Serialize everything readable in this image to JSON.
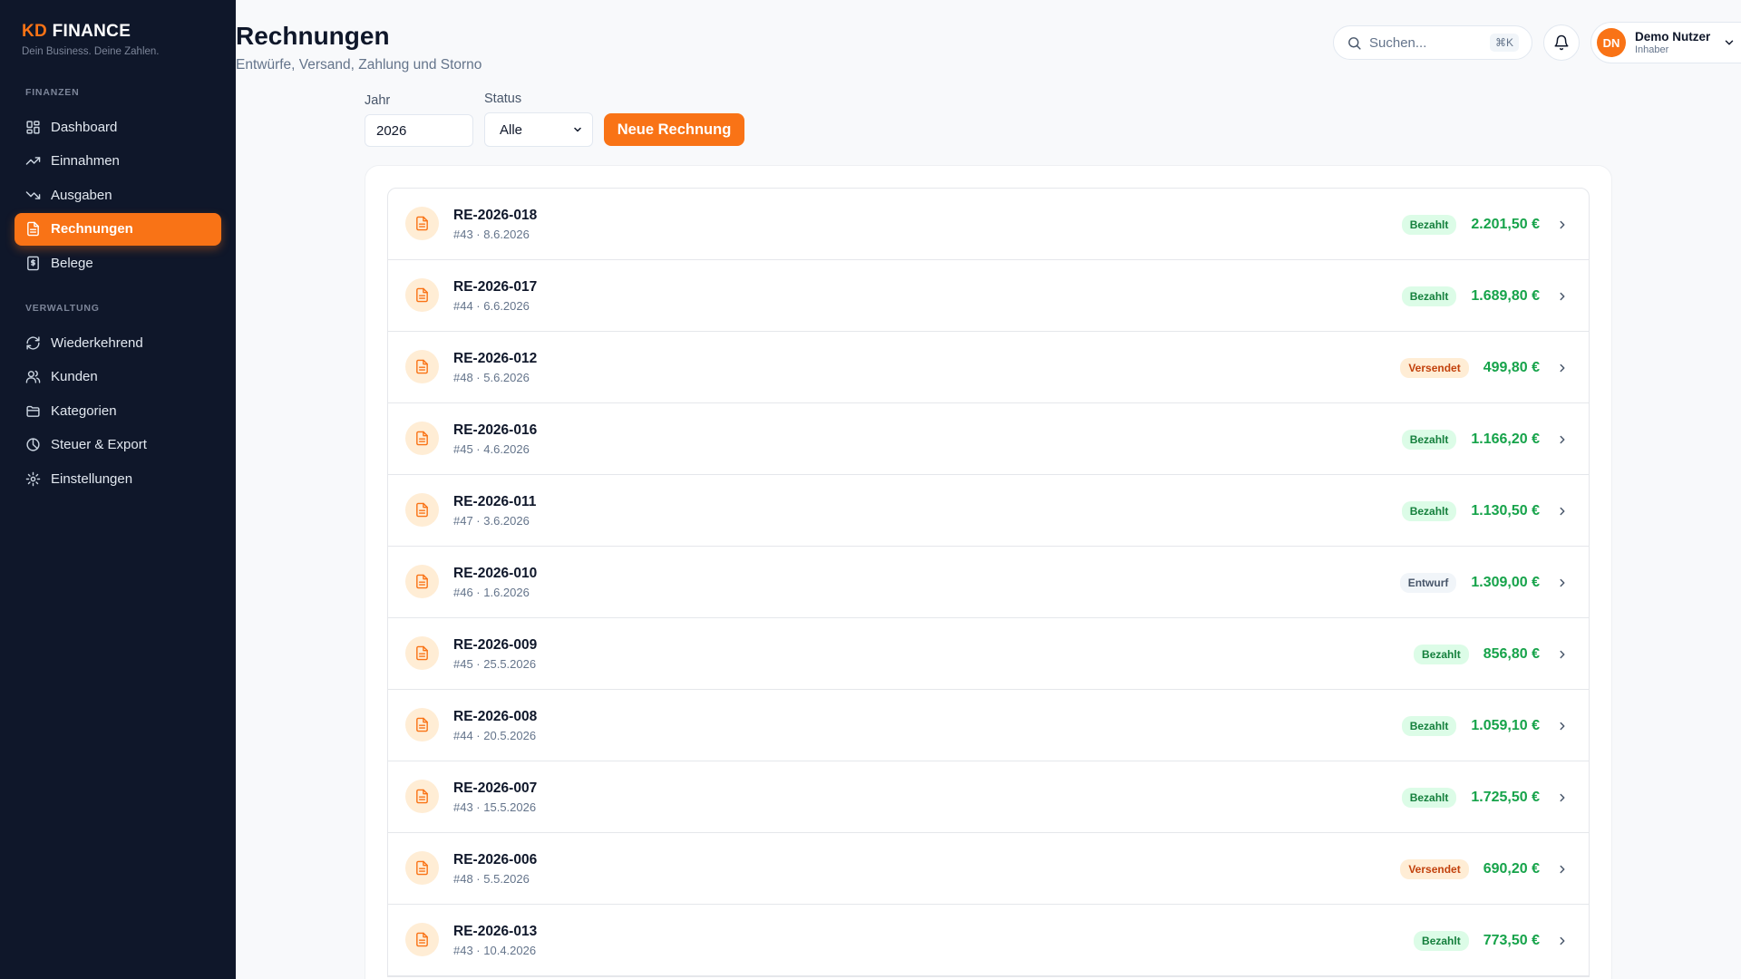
{
  "brand": {
    "kd": "KD",
    "name": " FINANCE",
    "tagline": "Dein Business. Deine Zahlen."
  },
  "sidebar": {
    "section_finance": "FINANZEN",
    "finance_items": [
      {
        "label": "Dashboard",
        "icon": "dashboard-icon"
      },
      {
        "label": "Einnahmen",
        "icon": "trending-up-icon"
      },
      {
        "label": "Ausgaben",
        "icon": "trending-down-icon"
      },
      {
        "label": "Rechnungen",
        "icon": "file-text-icon",
        "active": true
      },
      {
        "label": "Belege",
        "icon": "receipt-icon"
      }
    ],
    "section_admin": "VERWALTUNG",
    "admin_items": [
      {
        "label": "Wiederkehrend",
        "icon": "refresh-icon"
      },
      {
        "label": "Kunden",
        "icon": "users-icon"
      },
      {
        "label": "Kategorien",
        "icon": "folder-icon"
      },
      {
        "label": "Steuer & Export",
        "icon": "pie-chart-icon"
      },
      {
        "label": "Einstellungen",
        "icon": "gear-icon"
      }
    ]
  },
  "header": {
    "title": "Rechnungen",
    "subtitle": "Entwürfe, Versand, Zahlung und Storno",
    "search_placeholder": "Suchen...",
    "search_shortcut": "⌘K",
    "user_initials": "DN",
    "user_name": "Demo Nutzer",
    "user_role": "Inhaber"
  },
  "filters": {
    "year_label": "Jahr",
    "year_value": "2026",
    "status_label": "Status",
    "status_value": "Alle",
    "new_button": "Neue Rechnung"
  },
  "invoices": [
    {
      "number": "RE-2026-018",
      "meta": "#43 · 8.6.2026",
      "status": "Bezahlt",
      "status_kind": "bezahlt",
      "amount": "2.201,50 €"
    },
    {
      "number": "RE-2026-017",
      "meta": "#44 · 6.6.2026",
      "status": "Bezahlt",
      "status_kind": "bezahlt",
      "amount": "1.689,80 €"
    },
    {
      "number": "RE-2026-012",
      "meta": "#48 · 5.6.2026",
      "status": "Versendet",
      "status_kind": "versendet",
      "amount": "499,80 €"
    },
    {
      "number": "RE-2026-016",
      "meta": "#45 · 4.6.2026",
      "status": "Bezahlt",
      "status_kind": "bezahlt",
      "amount": "1.166,20 €"
    },
    {
      "number": "RE-2026-011",
      "meta": "#47 · 3.6.2026",
      "status": "Bezahlt",
      "status_kind": "bezahlt",
      "amount": "1.130,50 €"
    },
    {
      "number": "RE-2026-010",
      "meta": "#46 · 1.6.2026",
      "status": "Entwurf",
      "status_kind": "entwurf",
      "amount": "1.309,00 €"
    },
    {
      "number": "RE-2026-009",
      "meta": "#45 · 25.5.2026",
      "status": "Bezahlt",
      "status_kind": "bezahlt",
      "amount": "856,80 €"
    },
    {
      "number": "RE-2026-008",
      "meta": "#44 · 20.5.2026",
      "status": "Bezahlt",
      "status_kind": "bezahlt",
      "amount": "1.059,10 €"
    },
    {
      "number": "RE-2026-007",
      "meta": "#43 · 15.5.2026",
      "status": "Bezahlt",
      "status_kind": "bezahlt",
      "amount": "1.725,50 €"
    },
    {
      "number": "RE-2026-006",
      "meta": "#48 · 5.5.2026",
      "status": "Versendet",
      "status_kind": "versendet",
      "amount": "690,20 €"
    },
    {
      "number": "RE-2026-013",
      "meta": "#43 · 10.4.2026",
      "status": "Bezahlt",
      "status_kind": "bezahlt",
      "amount": "773,50 €"
    }
  ],
  "colors": {
    "accent": "#f97316",
    "sidebar_bg": "#0f172a",
    "paid": "#16a34a"
  }
}
